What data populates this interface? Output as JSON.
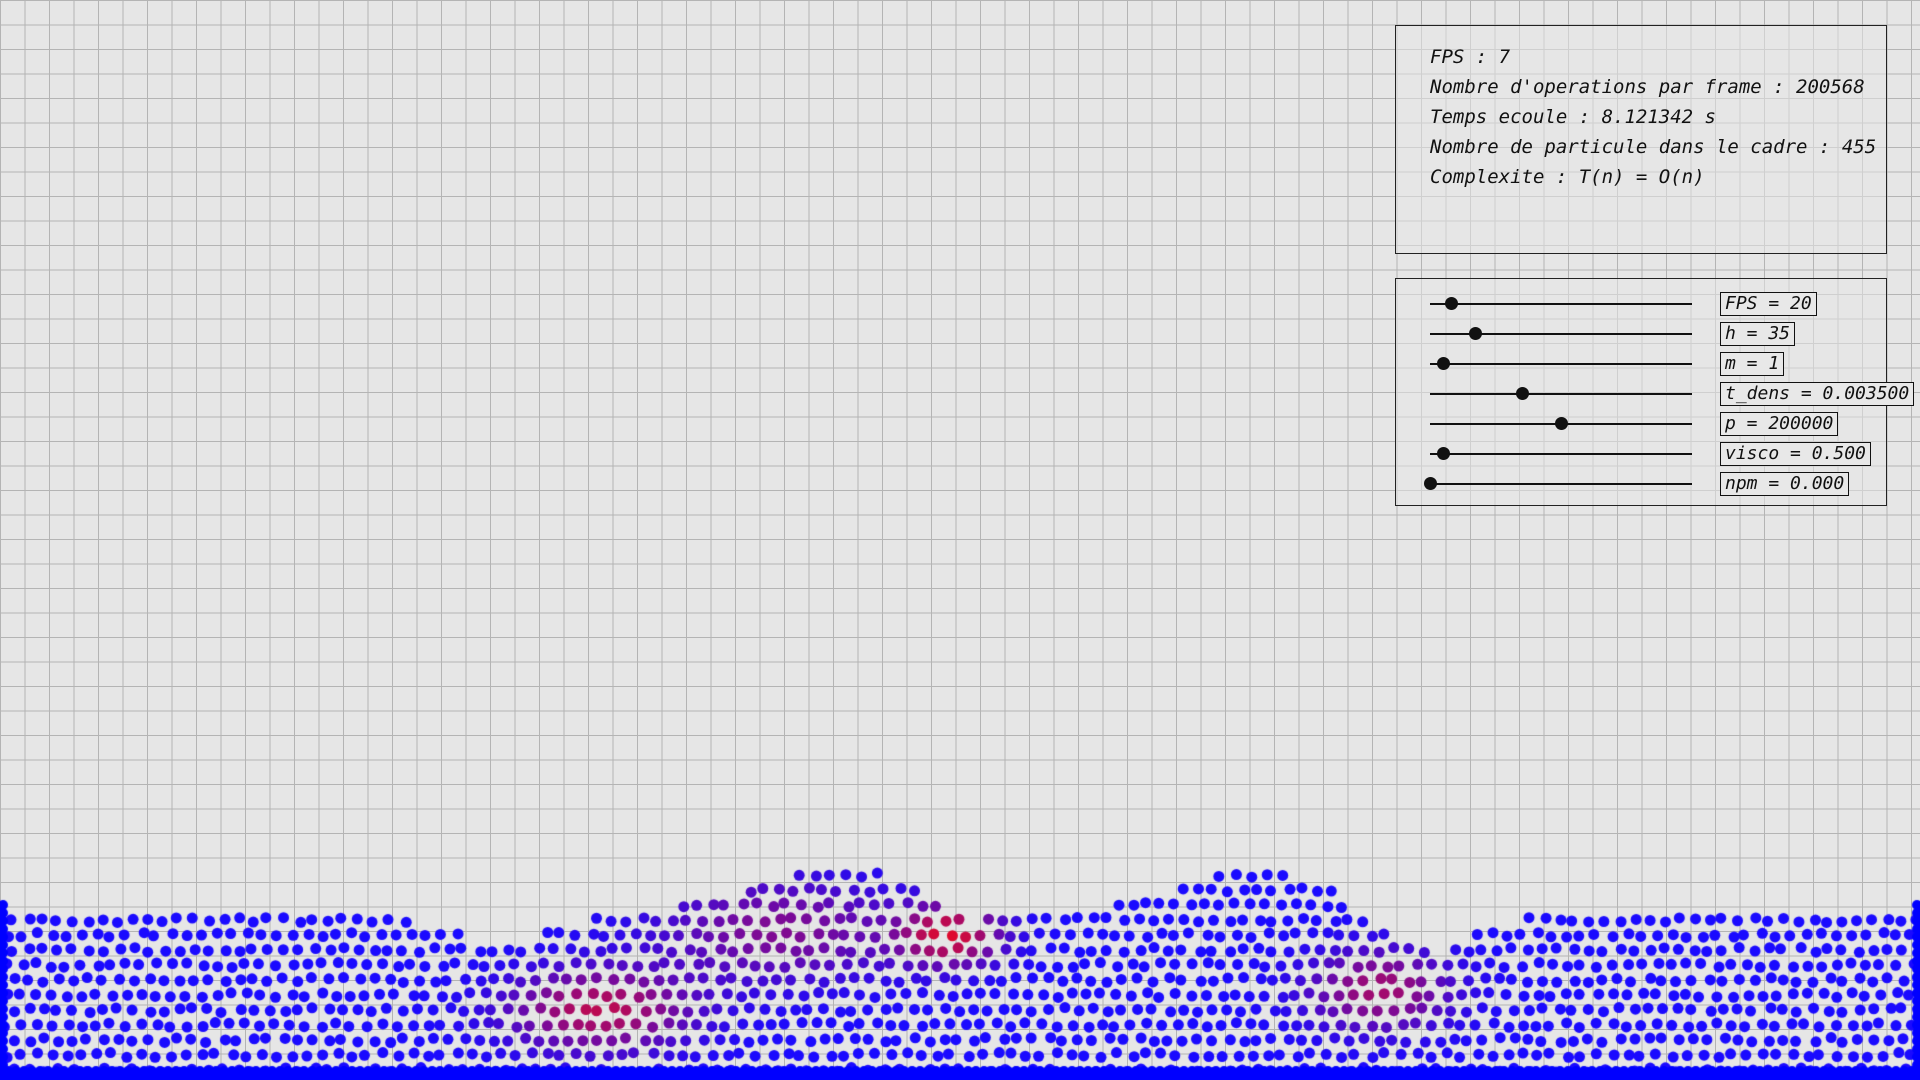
{
  "stats": {
    "fps": {
      "label": "FPS : ",
      "value": "7"
    },
    "operations": {
      "label": "Nombre d'operations par frame : ",
      "value": "200568"
    },
    "elapsed": {
      "label": "Temps ecoule : ",
      "value": "8.121342 s"
    },
    "particles": {
      "label": "Nombre de particule dans le cadre : ",
      "value": "455"
    },
    "complexity": {
      "label": "Complexite : ",
      "value": "T(n) = O(n)"
    }
  },
  "sliders": [
    {
      "name": "fps",
      "text": "FPS = 20",
      "position": 0.08
    },
    {
      "name": "h",
      "text": "h = 35",
      "position": 0.17
    },
    {
      "name": "m",
      "text": "m = 1",
      "position": 0.05
    },
    {
      "name": "t-dens",
      "text": "t_dens = 0.003500",
      "position": 0.35
    },
    {
      "name": "p",
      "text": "p = 200000",
      "position": 0.5
    },
    {
      "name": "visco",
      "text": "visco = 0.500",
      "position": 0.05
    },
    {
      "name": "npm",
      "text": "npm = 0.000",
      "position": 0.0
    }
  ],
  "colors": {
    "background": "#e6e6e6",
    "grid": "#b4b4b4",
    "particle_low": "#1a0aff",
    "particle_high": "#ff0a0a",
    "floor": "#0000ff"
  },
  "icons": {
    "slider_knob": "filled-circle"
  }
}
